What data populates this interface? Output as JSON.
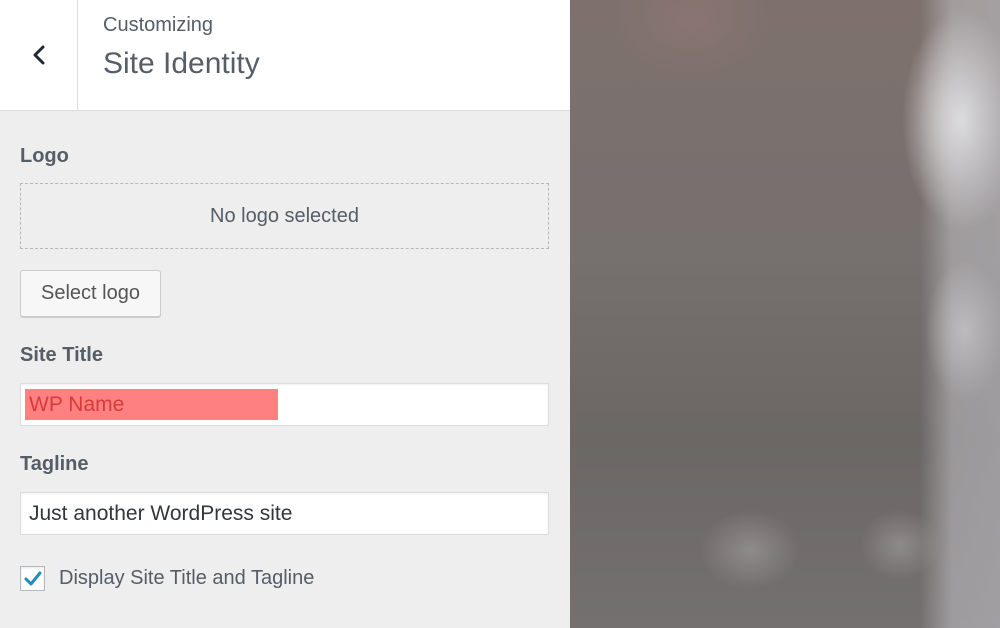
{
  "header": {
    "eyebrow": "Customizing",
    "title": "Site Identity"
  },
  "logo": {
    "label": "Logo",
    "placeholder": "No logo selected",
    "select_button": "Select logo"
  },
  "site_title": {
    "label": "Site Title",
    "value": "WP Name"
  },
  "tagline": {
    "label": "Tagline",
    "value": "Just another WordPress site"
  },
  "display_toggle": {
    "label": "Display Site Title and Tagline",
    "checked": true
  },
  "colors": {
    "accent": "#1e8cbe",
    "highlight": "#ff8080"
  },
  "icons": {
    "back": "chevron-left-icon",
    "check": "checkmark-icon"
  }
}
